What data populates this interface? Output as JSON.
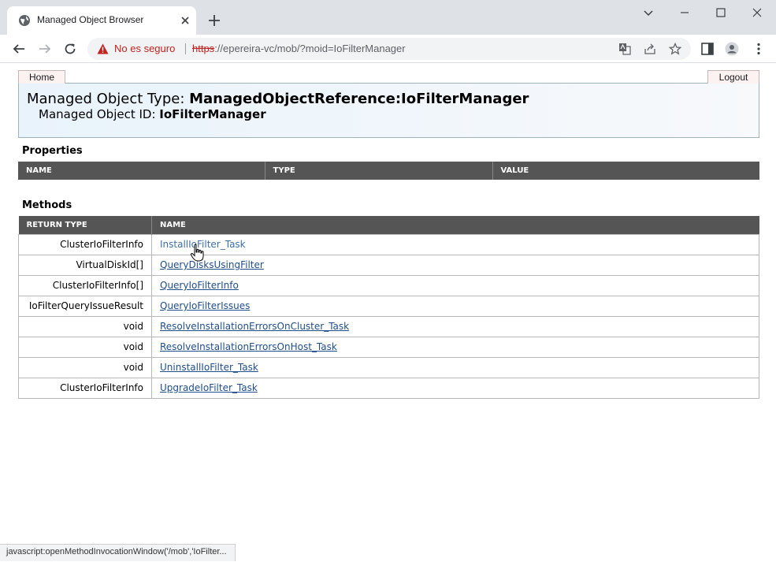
{
  "browser": {
    "tab_title": "Managed Object Browser",
    "security_warning": "No es seguro",
    "url_scheme": "https",
    "url_rest": "://epereira-vc/mob/?moid=IoFilterManager"
  },
  "header": {
    "home_label": "Home",
    "logout_label": "Logout",
    "type_prefix": "Managed Object Type: ",
    "type_value": "ManagedObjectReference:IoFilterManager",
    "id_prefix": "Managed Object ID: ",
    "id_value": "IoFilterManager"
  },
  "properties": {
    "title": "Properties",
    "columns": [
      "NAME",
      "TYPE",
      "VALUE"
    ]
  },
  "methods": {
    "title": "Methods",
    "columns": [
      "RETURN TYPE",
      "NAME"
    ],
    "rows": [
      {
        "return_type": "ClusterIoFilterInfo",
        "name": "InstallIoFilter_Task"
      },
      {
        "return_type": "VirtualDiskId[]",
        "name": "QueryDisksUsingFilter"
      },
      {
        "return_type": "ClusterIoFilterInfo[]",
        "name": "QueryIoFilterInfo"
      },
      {
        "return_type": "IoFilterQueryIssueResult",
        "name": "QueryIoFilterIssues"
      },
      {
        "return_type": "void",
        "name": "ResolveInstallationErrorsOnCluster_Task"
      },
      {
        "return_type": "void",
        "name": "ResolveInstallationErrorsOnHost_Task"
      },
      {
        "return_type": "void",
        "name": "UninstallIoFilter_Task"
      },
      {
        "return_type": "ClusterIoFilterInfo",
        "name": "UpgradeIoFilter_Task"
      }
    ]
  },
  "status_bar": "javascript:openMethodInvocationWindow('/mob','IoFilter..."
}
